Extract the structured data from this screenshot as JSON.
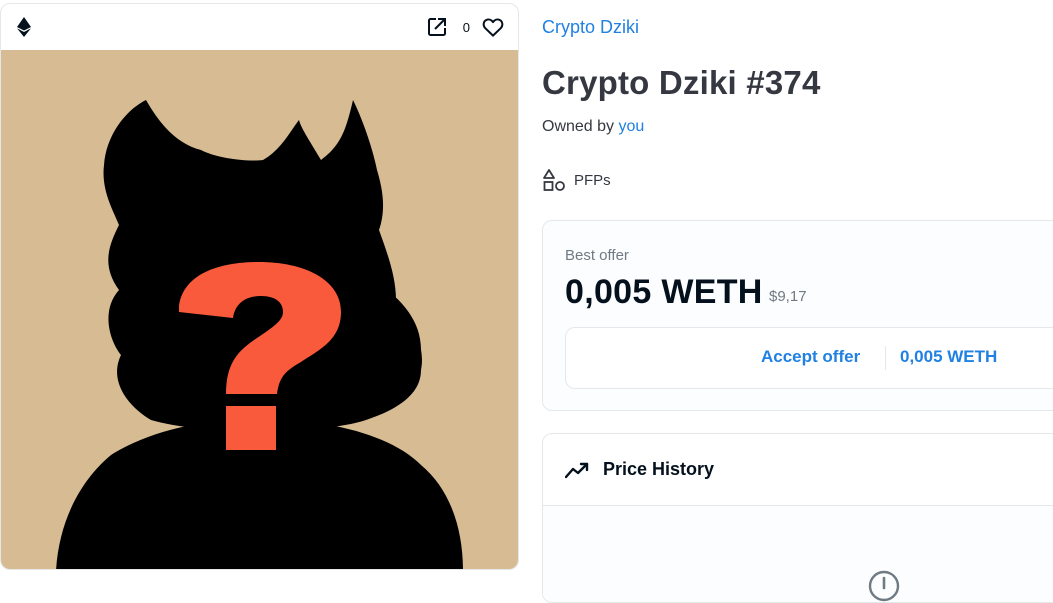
{
  "card": {
    "chain_icon": "ethereum-icon",
    "open_icon": "external-link-icon",
    "favorites_count": "0",
    "favorite_icon": "heart-outline-icon",
    "art_background": "#d6bb93",
    "art_question_color": "#fa5a3c"
  },
  "item": {
    "collection": "Crypto Dziki",
    "title": "Crypto Dziki #374",
    "owned_prefix": "Owned by",
    "owner": "you",
    "category_icon": "shapes-icon",
    "category": "PFPs"
  },
  "offer": {
    "label": "Best offer",
    "amount": "0,005 WETH",
    "fiat": "$9,17",
    "accept_label": "Accept offer",
    "accept_amount": "0,005 WETH"
  },
  "history": {
    "icon": "trending-line-icon",
    "title": "Price History",
    "empty_icon": "info-circle-icon"
  },
  "colors": {
    "link": "#2081e2",
    "text": "#353840",
    "muted": "#707a83",
    "border": "#e5e8eb"
  }
}
